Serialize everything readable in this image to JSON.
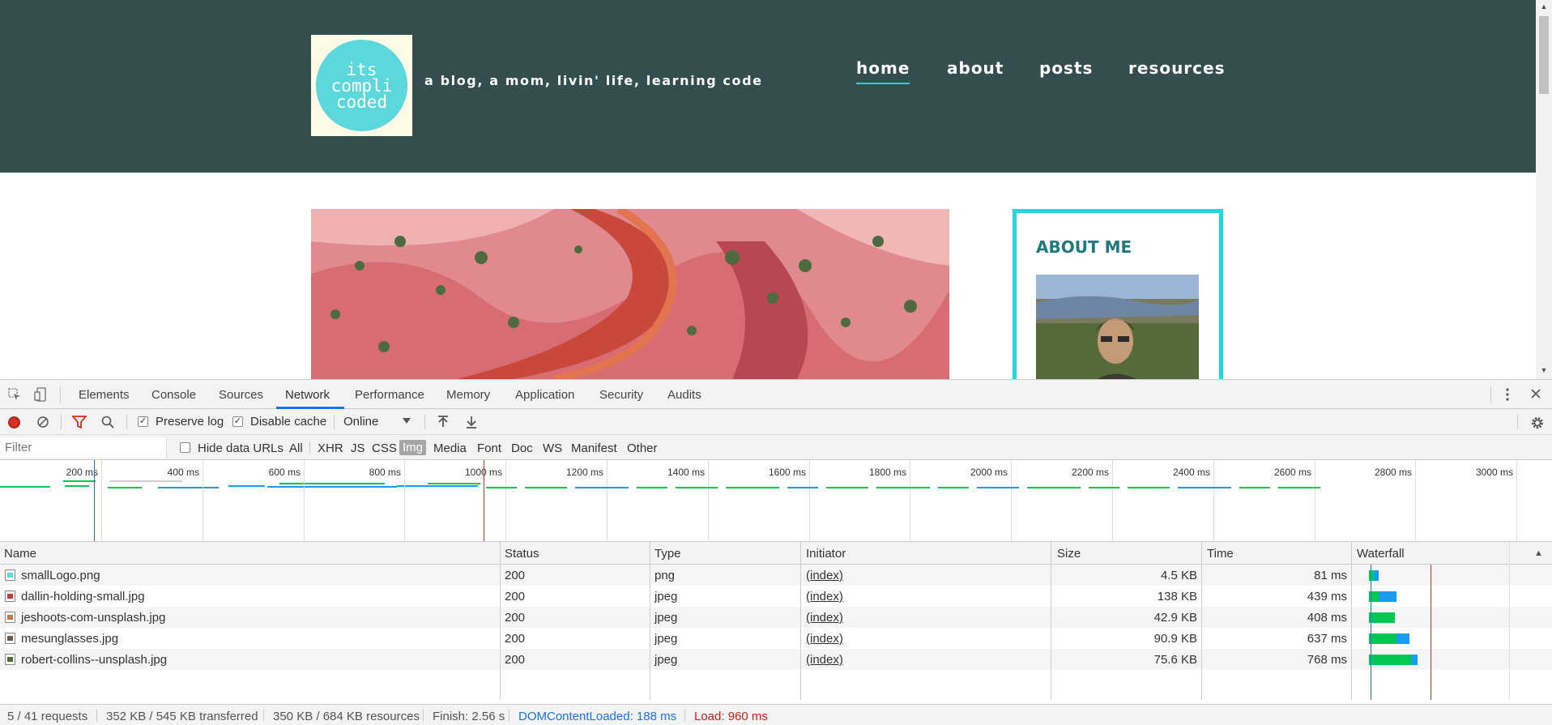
{
  "site": {
    "logo_lines": [
      "its",
      "compli",
      "coded"
    ],
    "tagline": "a blog, a mom, livin' life, learning code",
    "nav": [
      {
        "label": "home",
        "active": true
      },
      {
        "label": "about",
        "active": false
      },
      {
        "label": "posts",
        "active": false
      },
      {
        "label": "resources",
        "active": false
      }
    ],
    "sidebar": {
      "title": "ABOUT ME"
    },
    "colors": {
      "header_bg": "#344d4f",
      "accent": "#1fd8dd",
      "title": "#1e7a7e"
    }
  },
  "devtools": {
    "tabs": [
      "Elements",
      "Console",
      "Sources",
      "Network",
      "Performance",
      "Memory",
      "Application",
      "Security",
      "Audits"
    ],
    "active_tab": "Network",
    "toolbar": {
      "preserve_log": {
        "label": "Preserve log",
        "checked": true
      },
      "disable_cache": {
        "label": "Disable cache",
        "checked": true
      },
      "throttle": "Online"
    },
    "filter": {
      "placeholder": "Filter",
      "hide_data_urls": {
        "label": "Hide data URLs",
        "checked": false
      },
      "types": [
        "All",
        "XHR",
        "JS",
        "CSS",
        "Img",
        "Media",
        "Font",
        "Doc",
        "WS",
        "Manifest",
        "Other"
      ],
      "active_type": "Img"
    },
    "overview": {
      "ticks": [
        "200 ms",
        "400 ms",
        "600 ms",
        "800 ms",
        "1000 ms",
        "1200 ms",
        "1400 ms",
        "1600 ms",
        "1800 ms",
        "2000 ms",
        "2200 ms",
        "2400 ms",
        "2600 ms",
        "2800 ms",
        "3000 ms"
      ]
    },
    "columns": [
      "Name",
      "Status",
      "Type",
      "Initiator",
      "Size",
      "Time",
      "Waterfall"
    ],
    "rows": [
      {
        "name": "smallLogo.png",
        "status": "200",
        "type": "png",
        "initiator": "(index)",
        "size": "4.5 KB",
        "time": "81 ms",
        "wait_ms": 0,
        "download_ms": 81,
        "icon_color": "#5cd7dc"
      },
      {
        "name": "dallin-holding-small.jpg",
        "status": "200",
        "type": "jpeg",
        "initiator": "(index)",
        "size": "138 KB",
        "time": "439 ms",
        "wait_ms": 160,
        "download_ms": 279,
        "icon_color": "#b84040"
      },
      {
        "name": "jeshoots-com-unsplash.jpg",
        "status": "200",
        "type": "jpeg",
        "initiator": "(index)",
        "size": "42.9 KB",
        "time": "408 ms",
        "wait_ms": 408,
        "download_ms": 0,
        "icon_color": "#c9744a"
      },
      {
        "name": "mesunglasses.jpg",
        "status": "200",
        "type": "jpeg",
        "initiator": "(index)",
        "size": "90.9 KB",
        "time": "637 ms",
        "wait_ms": 430,
        "download_ms": 207,
        "icon_color": "#6b5a4a"
      },
      {
        "name": "robert-collins--unsplash.jpg",
        "status": "200",
        "type": "jpeg",
        "initiator": "(index)",
        "size": "75.6 KB",
        "time": "768 ms",
        "wait_ms": 670,
        "download_ms": 98,
        "icon_color": "#4f6b3a"
      }
    ],
    "status_bar": {
      "requests": "5 / 41 requests",
      "transferred": "352 KB / 545 KB transferred",
      "resources": "350 KB / 684 KB resources",
      "finish": "Finish: 2.56 s",
      "dcl": "DOMContentLoaded: 188 ms",
      "load": "Load: 960 ms"
    },
    "colors": {
      "waiting": "#00c853",
      "download": "#1a9bf0",
      "dcl_line": "#1a73e8",
      "load_line": "#d93025"
    }
  }
}
